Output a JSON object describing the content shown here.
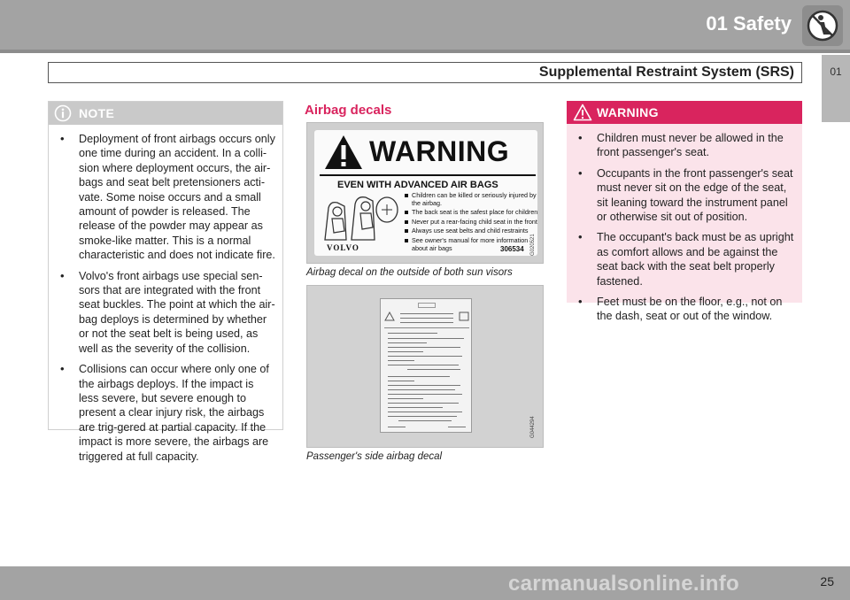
{
  "header": {
    "chapter": "01 Safety",
    "section": "Supplemental Restraint System (SRS)",
    "side_tab": "01"
  },
  "note": {
    "title": "NOTE",
    "items": [
      "Deployment of front airbags occurs only one time during an accident. In a colli-sion where deployment occurs, the air-bags and seat belt pretensioners acti-vate. Some noise occurs and a small amount of powder is released. The release of the powder may appear as smoke-like matter. This is a normal characteristic and does not indicate fire.",
      "Volvo's front airbags use special sen-sors that are integrated with the front seat buckles. The point at which the air-bag deploys is determined by whether or not the seat belt is being used, as well as the severity of the collision.",
      "Collisions can occur where only one of the airbags deploys. If the impact is less severe, but severe enough to present a clear injury risk, the airbags are trig-gered at partial capacity. If the impact is more severe, the airbags are triggered at full capacity."
    ]
  },
  "decals": {
    "heading": "Airbag decals",
    "decal1": {
      "warning_word": "WARNING",
      "headline": "EVEN WITH ADVANCED AIR BAGS",
      "lines": [
        "Children can be killed or seriously injured by the airbag.",
        "The back seat is the safest place for children",
        "Never put a rear-facing child seat in the front",
        "Always use seat belts and child restraints",
        "See owner's manual for more information about air bags"
      ],
      "brand": "VOLVO",
      "code": "306534",
      "figure_id": "G020521",
      "caption": "Airbag decal on the outside of both sun visors"
    },
    "decal2": {
      "figure_id": "G044294",
      "caption": "Passenger's side airbag decal"
    }
  },
  "warning": {
    "title": "WARNING",
    "items": [
      "Children must never be allowed in the front passenger's seat.",
      "Occupants in the front passenger's seat must never sit on the edge of the seat, sit leaning toward the instrument panel or otherwise sit out of position.",
      "The occupant's back must be as upright as comfort allows and be against the seat back with the seat belt properly fastened.",
      "Feet must be on the floor, e.g., not on the dash, seat or out of the window."
    ]
  },
  "footer": {
    "page": "25",
    "watermark": "carmanualsonline.info"
  },
  "colors": {
    "band": "#a3a3a3",
    "accent": "#d9245e",
    "warning_bg": "#fbe3ea",
    "note_header": "#c9c9c9"
  },
  "icons": {
    "chapter": "no-airbag-icon",
    "note": "info-circle-icon",
    "warning": "warning-triangle-icon"
  }
}
